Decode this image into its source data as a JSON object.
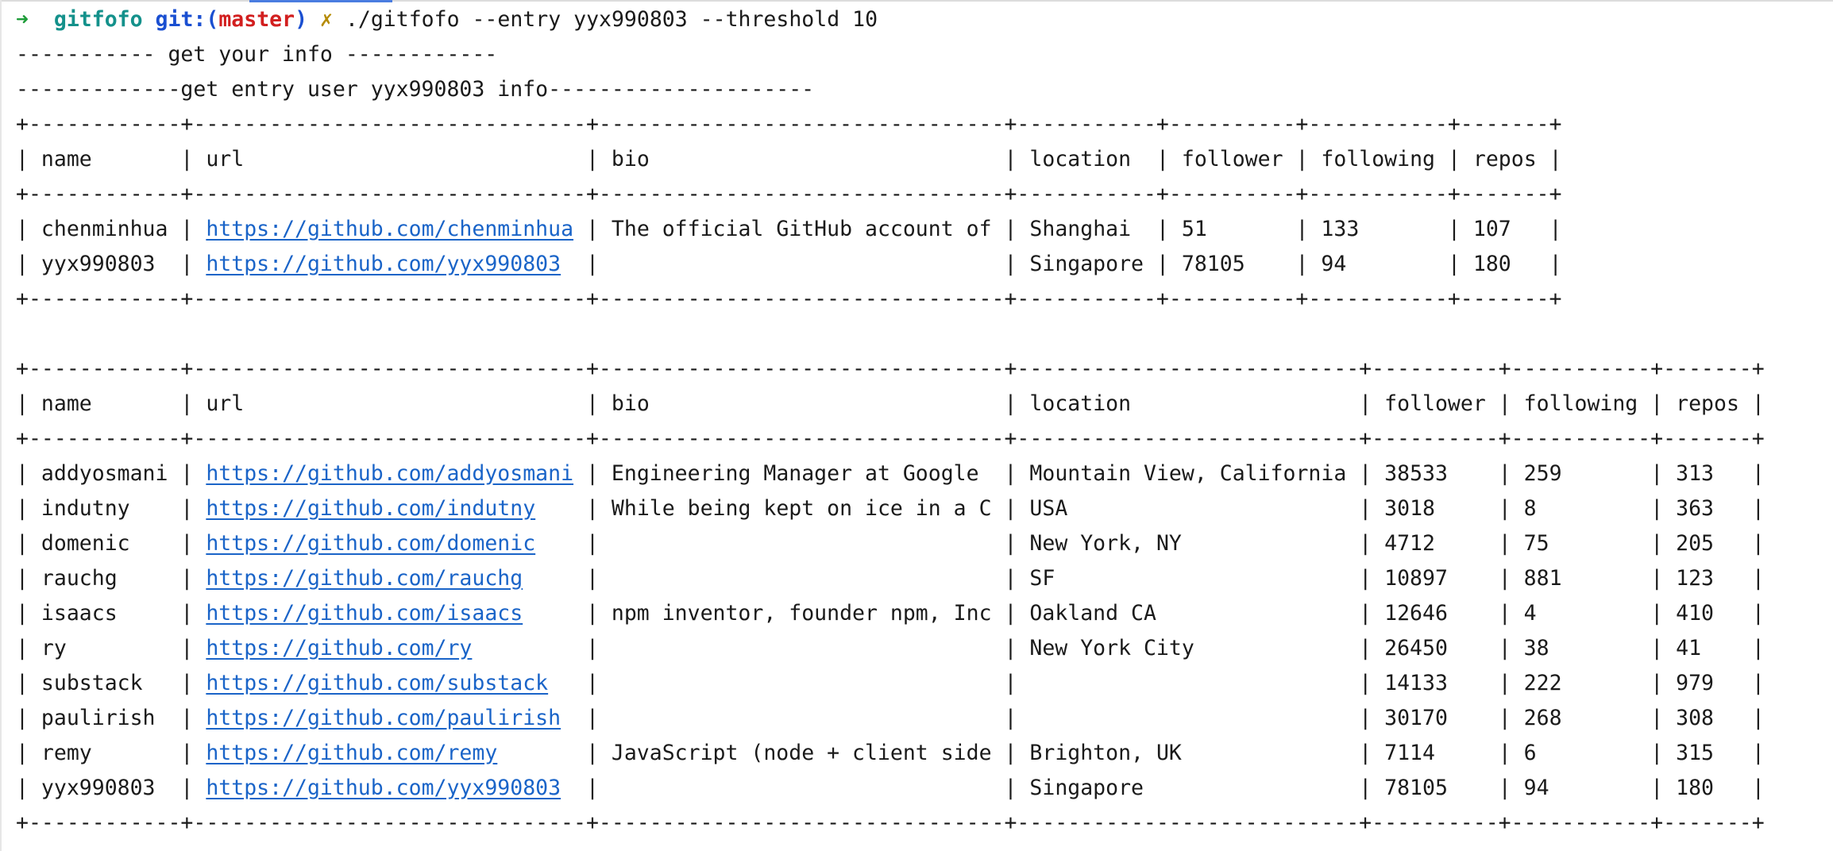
{
  "prompt": {
    "arrow": "➜",
    "dir": "gitfofo",
    "git_label": "git:(",
    "branch": "master",
    "git_close": ")",
    "dirty_mark": "✗",
    "command": "./gitfofo --entry yyx990803 --threshold 10"
  },
  "output": {
    "header1": "----------- get your info ------------",
    "header2": "-------------get entry user yyx990803 info---------------------"
  },
  "table1": {
    "columns": [
      "name",
      "url",
      "bio",
      "location",
      "follower",
      "following",
      "repos"
    ],
    "rows": [
      {
        "name": "chenminhua",
        "url": "https://github.com/chenminhua",
        "bio": "The official GitHub account of",
        "location": "Shanghai",
        "follower": "51",
        "following": "133",
        "repos": "107"
      },
      {
        "name": "yyx990803",
        "url": "https://github.com/yyx990803",
        "bio": "",
        "location": "Singapore",
        "follower": "78105",
        "following": "94",
        "repos": "180"
      }
    ]
  },
  "table2": {
    "columns": [
      "name",
      "url",
      "bio",
      "location",
      "follower",
      "following",
      "repos"
    ],
    "rows": [
      {
        "name": "addyosmani",
        "url": "https://github.com/addyosmani",
        "bio": "Engineering Manager at Google",
        "location": "Mountain View, California",
        "follower": "38533",
        "following": "259",
        "repos": "313"
      },
      {
        "name": "indutny",
        "url": "https://github.com/indutny",
        "bio": "While being kept on ice in a C",
        "location": "USA",
        "follower": "3018",
        "following": "8",
        "repos": "363"
      },
      {
        "name": "domenic",
        "url": "https://github.com/domenic",
        "bio": "",
        "location": "New York, NY",
        "follower": "4712",
        "following": "75",
        "repos": "205"
      },
      {
        "name": "rauchg",
        "url": "https://github.com/rauchg",
        "bio": "",
        "location": "SF",
        "follower": "10897",
        "following": "881",
        "repos": "123"
      },
      {
        "name": "isaacs",
        "url": "https://github.com/isaacs",
        "bio": "npm inventor, founder npm, Inc",
        "location": "Oakland CA",
        "follower": "12646",
        "following": "4",
        "repos": "410"
      },
      {
        "name": "ry",
        "url": "https://github.com/ry",
        "bio": "",
        "location": "New York City",
        "follower": "26450",
        "following": "38",
        "repos": "41"
      },
      {
        "name": "substack",
        "url": "https://github.com/substack",
        "bio": "",
        "location": "",
        "follower": "14133",
        "following": "222",
        "repos": "979"
      },
      {
        "name": "paulirish",
        "url": "https://github.com/paulirish",
        "bio": "",
        "location": "",
        "follower": "30170",
        "following": "268",
        "repos": "308"
      },
      {
        "name": "remy",
        "url": "https://github.com/remy",
        "bio": "JavaScript (node + client side",
        "location": "Brighton, UK",
        "follower": "7114",
        "following": "6",
        "repos": "315"
      },
      {
        "name": "yyx990803",
        "url": "https://github.com/yyx990803",
        "bio": "",
        "location": "Singapore",
        "follower": "78105",
        "following": "94",
        "repos": "180"
      }
    ]
  },
  "colors": {
    "arrow": "#1f9d3a",
    "dir": "#14918b",
    "git": "#1a4fd1",
    "branch": "#d21f1f",
    "dirty": "#b58a00",
    "link": "#1a64c8",
    "text": "#1a1a1a"
  }
}
